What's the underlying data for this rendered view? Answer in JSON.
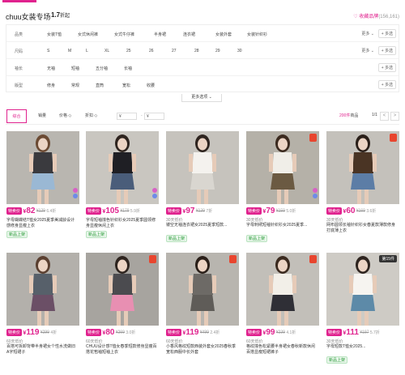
{
  "header": {
    "store_name": "chuu女装专场",
    "discount_value": "1.7",
    "discount_unit": "折起",
    "fav_label": "♡ 收藏品牌",
    "fav_count": "(156,161)"
  },
  "filters": {
    "rows": [
      {
        "label": "品类",
        "options": [
          "女装T恤",
          "女式休闲裤",
          "女式牛仔裤",
          "半身裙",
          "连衣裙",
          "女装外套",
          "女装针织衫"
        ],
        "more": "更多 ⌄",
        "multi": "+ 多选"
      },
      {
        "label": "尺码",
        "options": [
          "S",
          "M",
          "L",
          "XL",
          "25",
          "26",
          "27",
          "28",
          "29",
          "30"
        ],
        "more": "更多 ⌄",
        "multi": "+ 多选"
      },
      {
        "label": "袖长",
        "options": [
          "无袖",
          "短袖",
          "五分袖",
          "长袖"
        ],
        "more": "",
        "multi": "+ 多选"
      },
      {
        "label": "版型",
        "options": [
          "修身",
          "常规",
          "直筒",
          "宽松",
          "收腰"
        ],
        "more": "",
        "multi": "+ 多选"
      }
    ],
    "more_options": "更多选项 ⌄"
  },
  "sortbar": {
    "sorts": [
      "综合",
      "销量",
      "价格 ◇",
      "折扣 ◇"
    ],
    "price_min_placeholder": "¥",
    "price_max_placeholder": "¥",
    "dash": "-",
    "count_num": "200件",
    "count_word": "商品",
    "page": "1/1",
    "prev": "<",
    "next": ">"
  },
  "products": [
    {
      "tag": "特卖价",
      "price": "82",
      "orig": "¥129",
      "disc": "6.4折",
      "lowest": "",
      "title": "字母蝴蝶结T恤女2025夏季美减龄设计感修身显瘦上衣",
      "newtag": "新品上架",
      "badge": "",
      "colors": true,
      "bg": "#b9b6b0",
      "top": "#3a3a3e",
      "bottom": "#9ab8d4",
      "hair": "#6b4a33"
    },
    {
      "tag": "特卖价",
      "price": "105",
      "orig": "¥179",
      "disc": "5.9折",
      "lowest": "",
      "title": "字母短袖撞色针织衫女2025夏季圆领修身显瘦休闲上衣",
      "newtag": "新品上架",
      "badge": "",
      "colors": true,
      "bg": "#c9c6c0",
      "top": "#1f1f24",
      "bottom": "#4a5d7a",
      "hair": "#2e241f"
    },
    {
      "tag": "特卖价",
      "price": "97",
      "orig": "¥139",
      "disc": "7折",
      "lowest": "30天低价",
      "title": "镂空无袖连衣裙女2025夏季短款...",
      "newtag": "新品上架",
      "badge": "",
      "colors": false,
      "bg": "#c6c3bd",
      "top": "#f4f2ee",
      "bottom": "#d9d6d0",
      "hair": "#2e241f"
    },
    {
      "tag": "特卖价",
      "price": "79",
      "orig": "¥159",
      "disc": "5.0折",
      "lowest": "30天低价",
      "title": "字母刺绣短袖针织衫女2025夏季...",
      "newtag": "新品上架",
      "badge": "new",
      "colors": true,
      "bg": "#b5b1a8",
      "top": "#f0eee8",
      "bottom": "#6b5a42",
      "hair": "#3b2a1f"
    },
    {
      "tag": "特卖价",
      "price": "60",
      "orig": "¥169",
      "disc": "3.6折",
      "lowest": "30天低价",
      "title": "网布圆领长袖针织衫女春夏款薄款修身打底薄上衣",
      "newtag": "",
      "badge": "new",
      "colors": false,
      "bg": "#c4c1bb",
      "top": "#4a3424",
      "bottom": "#5c7da6",
      "hair": "#2a1f19"
    },
    {
      "tag": "特卖价",
      "price": "119",
      "orig": "¥299",
      "disc": "4折",
      "lowest": "60天低价",
      "title": "百搭可拆卸背带半身裙女个性水洗做旧A字短裙子",
      "newtag": "",
      "badge": "",
      "colors": false,
      "bg": "#b3b0ab",
      "top": "#57606a",
      "bottom": "#6b4f66",
      "hair": "#5a3f30"
    },
    {
      "tag": "特卖价",
      "price": "80",
      "orig": "¥269",
      "disc": "3.0折",
      "lowest": "60天低价",
      "title": "CHUU设计感T恤女春季短款修身显瘦百搭花苞袖短袖上衣",
      "newtag": "",
      "badge": "new",
      "colors": false,
      "bg": "#a7a49f",
      "top": "#4b4b4f",
      "bottom": "#e88fb2",
      "hair": "#2e241f"
    },
    {
      "tag": "特卖价",
      "price": "119",
      "orig": "¥499",
      "disc": "2.4折",
      "lowest": "60天低价",
      "title": "小香风格纹短款西装外套女2025春秋季宽松西服中长外套",
      "newtag": "",
      "badge": "new",
      "colors": false,
      "bg": "#b8b5af",
      "top": "#6d6a66",
      "bottom": "#5f5c58",
      "hair": "#2a1f19"
    },
    {
      "tag": "特卖价",
      "price": "99",
      "orig": "¥239",
      "disc": "4.1折",
      "lowest": "60天低价",
      "title": "格纹撞色松紧腰半身裙女春秋新款休闲百搭显瘦短裙裤子",
      "newtag": "",
      "badge": "new",
      "colors": false,
      "bg": "#c2bfb9",
      "top": "#f2efe8",
      "bottom": "#2f2f36",
      "hair": "#3b2a1f"
    },
    {
      "tag": "特卖价",
      "price": "111",
      "orig": "¥197",
      "disc": "5.7折",
      "lowest": "30天低价",
      "title": "字母短款T恤女2025...",
      "newtag": "新品上架",
      "badge": "第15件",
      "colors": false,
      "bg": "#cecbc5",
      "top": "#f6f4f0",
      "bottom": "#5d8aa8",
      "hair": "#2e241f"
    }
  ]
}
